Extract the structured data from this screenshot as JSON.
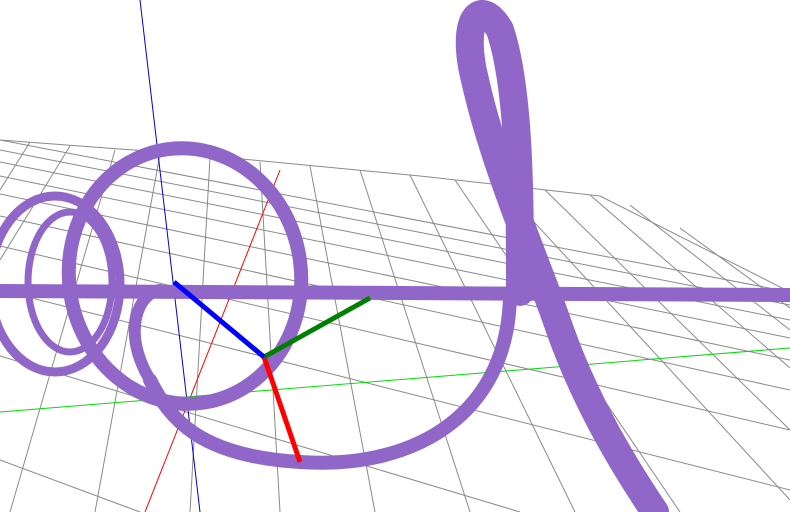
{
  "scene": {
    "background_color": "#ffffff",
    "grid_color": "#8a8a8a",
    "helix_color": "#9166c9",
    "axes": {
      "x_color": "#ff0000",
      "y_color": "#008000",
      "z_color": "#0000ff"
    },
    "guide_lines": {
      "x_color": "#ff0000",
      "y_color": "#00dd00",
      "z_color": "#0000cc"
    }
  }
}
